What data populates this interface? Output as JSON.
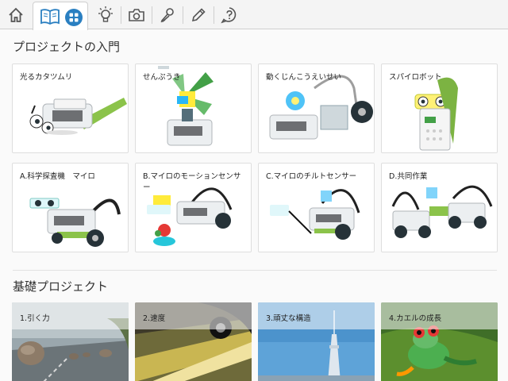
{
  "toolbar": {
    "items": [
      "home-icon",
      "book-icon",
      "grid-icon",
      "lightbulb-icon",
      "camera-icon",
      "microphone-icon",
      "pencil-icon",
      "help-icon"
    ],
    "accent": "#2a7fc1"
  },
  "getting_started": {
    "title": "プロジェクトの入門",
    "cards": [
      {
        "label": "光るカタツムリ"
      },
      {
        "label": "せんぷうき"
      },
      {
        "label": "動くじんこうえいせい"
      },
      {
        "label": "スパイロボット"
      },
      {
        "label": "A.科学探査機　マイロ"
      },
      {
        "label": "B.マイロのモーションセンサー"
      },
      {
        "label": "C.マイロのチルトセンサー"
      },
      {
        "label": "D.共同作業"
      }
    ]
  },
  "basic_projects": {
    "title": "基礎プロジェクト",
    "cards": [
      {
        "label": "1.引く力"
      },
      {
        "label": "2.速度"
      },
      {
        "label": "3.頑丈な構造"
      },
      {
        "label": "4.カエルの成長"
      }
    ]
  }
}
